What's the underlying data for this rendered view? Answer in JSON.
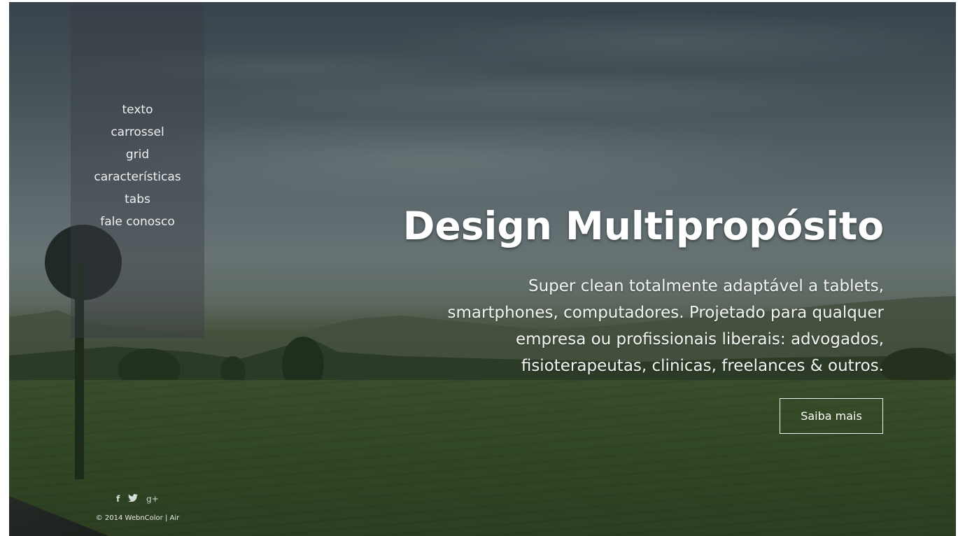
{
  "nav": {
    "items": [
      {
        "label": "texto"
      },
      {
        "label": "carrossel"
      },
      {
        "label": "grid"
      },
      {
        "label": "características"
      },
      {
        "label": "tabs"
      },
      {
        "label": "fale conosco"
      }
    ]
  },
  "hero": {
    "title": "Design Multipropósito",
    "description": "Super clean totalmente adaptável a tablets, smartphones, computadores. Projetado para qualquer empresa ou profissionais liberais: advogados, fisioterapeutas, clinicas, freelances & outros.",
    "cta_label": "Saiba mais"
  },
  "social": {
    "facebook_glyph": "f",
    "twitter_icon": "twitter-icon",
    "googleplus_glyph": "g+"
  },
  "footer": {
    "copyright": "© 2014 WebnColor | Air"
  }
}
